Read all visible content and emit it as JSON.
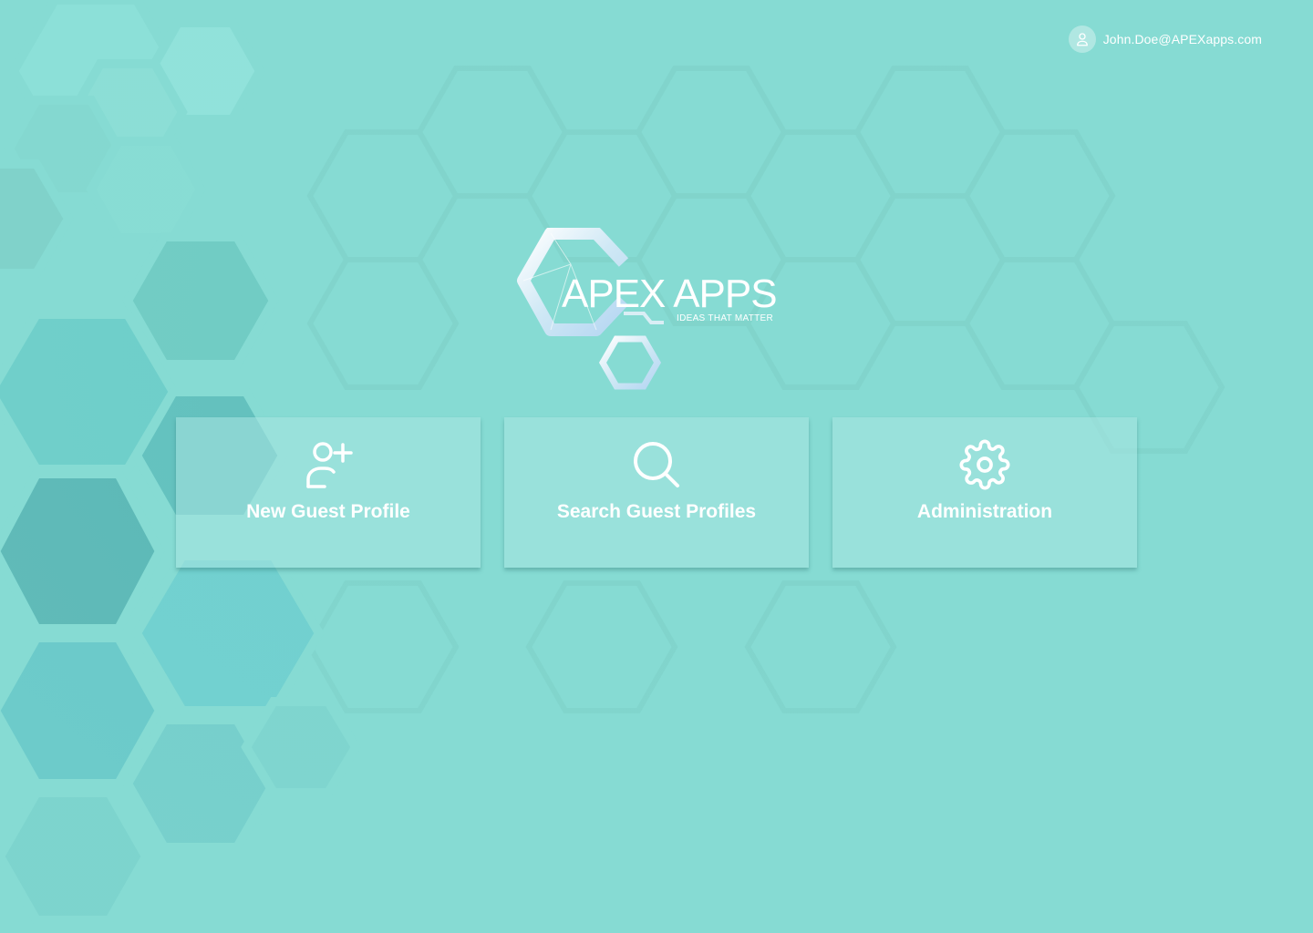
{
  "header": {
    "user_email": "John.Doe@APEXapps.com",
    "avatar_icon": "user-icon"
  },
  "logo": {
    "title": "APEX APPS",
    "tagline": "IDEAS THAT MATTER"
  },
  "cards": [
    {
      "label": "New Guest Profile",
      "icon": "user-plus-icon"
    },
    {
      "label": "Search Guest Profiles",
      "icon": "search-icon"
    },
    {
      "label": "Administration",
      "icon": "gear-icon"
    }
  ],
  "colors": {
    "background": "#86dbd3",
    "card": "#aae6e1",
    "text": "#ffffff"
  }
}
